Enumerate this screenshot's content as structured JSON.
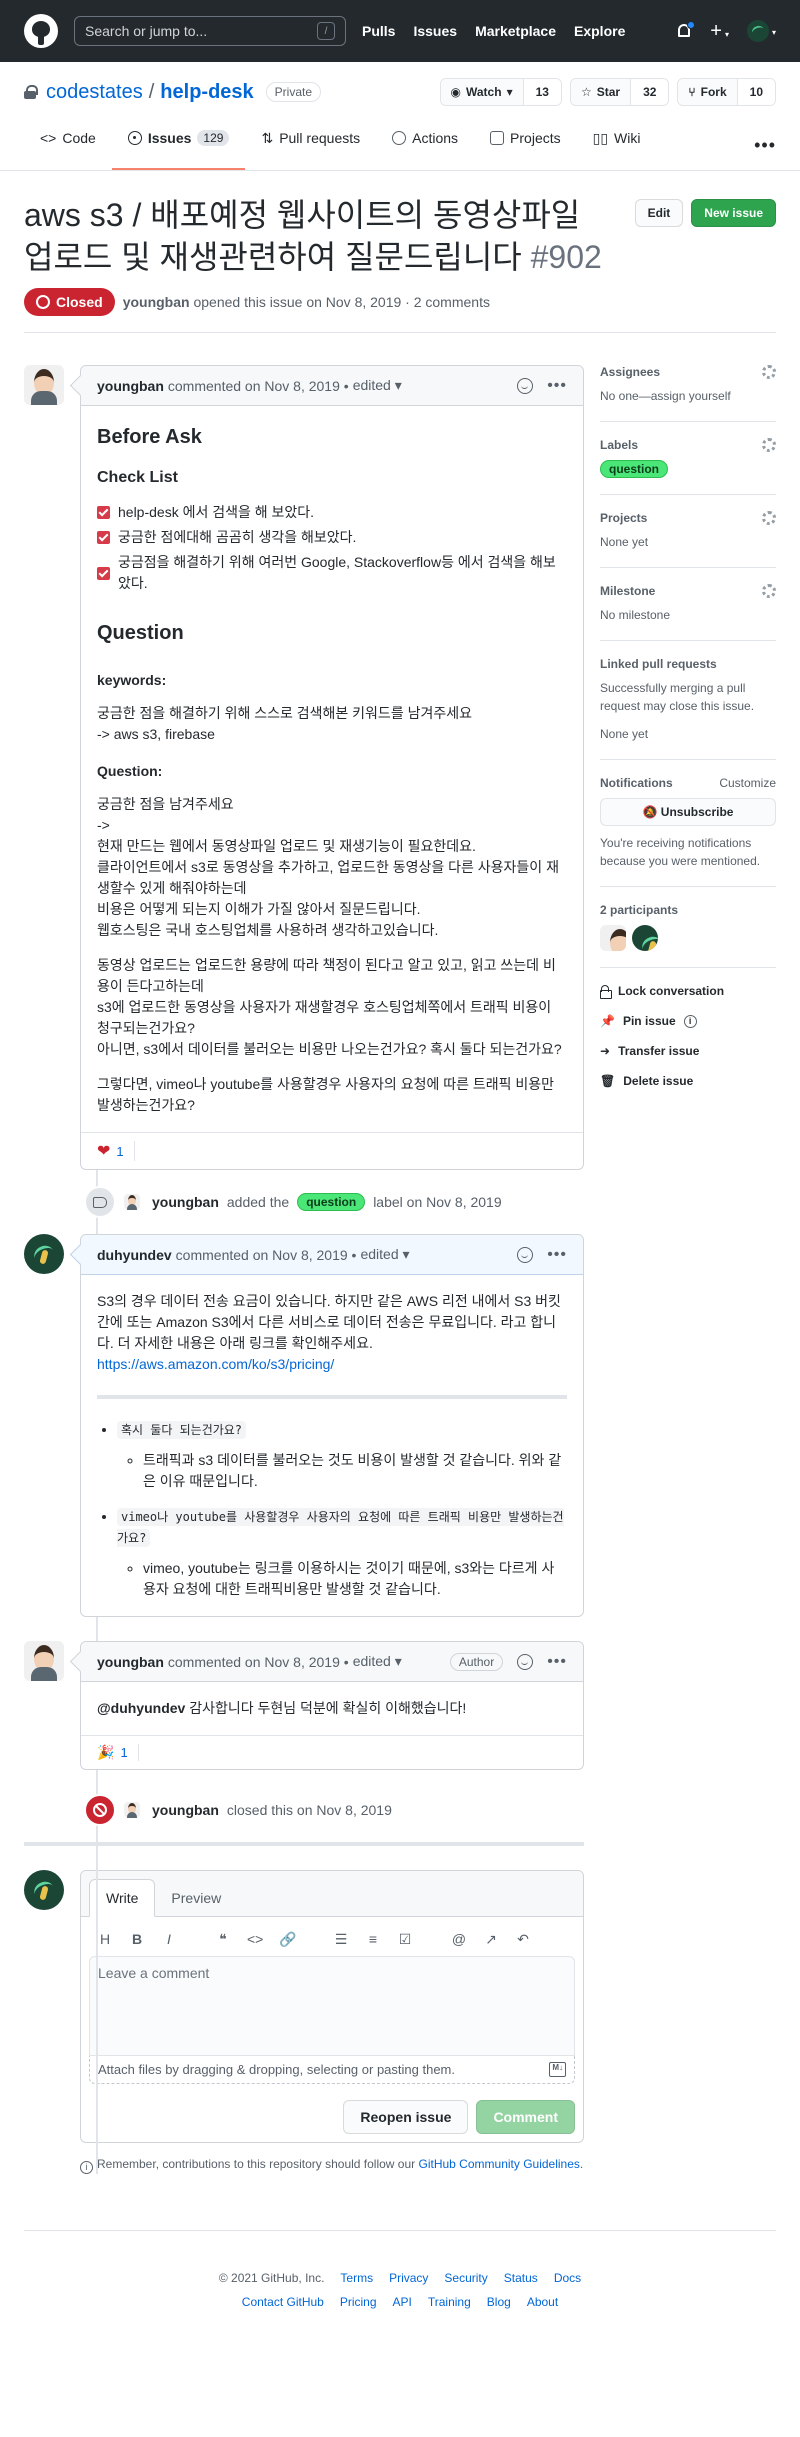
{
  "header": {
    "search_placeholder": "Search or jump to...",
    "slash_key": "/",
    "nav": [
      "Pulls",
      "Issues",
      "Marketplace",
      "Explore"
    ],
    "plus": "+",
    "caret": "▾"
  },
  "repo": {
    "owner": "codestates",
    "sep": "/",
    "name": "help-desk",
    "visibility": "Private",
    "watch_label": "Watch",
    "watch_count": "13",
    "star_label": "Star",
    "star_count": "32",
    "fork_label": "Fork",
    "fork_count": "10"
  },
  "tabs": {
    "code": "Code",
    "issues": "Issues",
    "issues_count": "129",
    "pulls": "Pull requests",
    "actions": "Actions",
    "projects": "Projects",
    "wiki": "Wiki",
    "more": "•••"
  },
  "issue": {
    "title": "aws s3 / 배포예정 웹사이트의 동영상파일 업로드 및 재생관련하여 질문드립니다",
    "number": "#902",
    "edit_label": "Edit",
    "new_issue_label": "New issue",
    "state": "Closed",
    "author": "youngban",
    "opened_text": "opened this issue on Nov 8, 2019 · 2 comments"
  },
  "comment1": {
    "author": "youngban",
    "meta": "commented on Nov 8, 2019 •",
    "edited": "edited ▾",
    "h_before": "Before Ask",
    "h_checklist": "Check List",
    "check1": "help-desk 에서 검색을 해 보았다.",
    "check2": "궁금한 점에대해 곰곰히 생각을 해보았다.",
    "check3": "궁금점을 해결하기 위해 여러번 Google, Stackoverflow등 에서 검색을 해보았다.",
    "h_question": "Question",
    "h_keywords": "keywords:",
    "kw_line1": "궁금한 점을 해결하기 위해 스스로 검색해본 키워드를 남겨주세요",
    "kw_line2": "-> aws s3, firebase",
    "h_question2": "Question:",
    "q_line1": "궁금한 점을 남겨주세요",
    "q_line2": "->",
    "q_line3": "현재 만드는 웹에서 동영상파일 업로드 및 재생기능이 필요한데요.",
    "q_line4": "클라이언트에서 s3로 동영상을 추가하고, 업로드한 동영상을 다른 사용자들이 재생할수 있게 해줘야하는데",
    "q_line5": "비용은 어떻게 되는지 이해가 가질 않아서 질문드립니다.",
    "q_line6": "웹호스팅은 국내 호스팅업체를 사용하려 생각하고있습니다.",
    "p2_line1": "동영상 업로드는 업로드한 용량에 따라 책정이 된다고 알고 있고, 읽고 쓰는데 비용이 든다고하는데",
    "p2_line2": "s3에 업로드한 동영상을 사용자가 재생할경우 호스팅업체쪽에서 트래픽 비용이 청구되는건가요?",
    "p2_line3": "아니면, s3에서 데이터를 불러오는 비용만 나오는건가요? 혹시 둘다 되는건가요?",
    "p3": "그렇다면, vimeo나 youtube를 사용할경우 사용자의 요청에 따른 트래픽 비용만 발생하는건가요?",
    "reaction_icon": "❤",
    "reaction_count": "1"
  },
  "event_label": {
    "actor": "youngban",
    "text_before": "added the",
    "label": "question",
    "text_after": "label on Nov 8, 2019"
  },
  "comment2": {
    "author": "duhyundev",
    "meta": "commented on Nov 8, 2019 •",
    "edited": "edited ▾",
    "p1": "S3의 경우 데이터 전송 요금이 있습니다. 하지만 같은 AWS 리전 내에서 S3 버킷 간에 또는 Amazon S3에서 다른 서비스로 데이터 전송은 무료입니다. 라고 합니다. 더 자세한 내용은 아래 링크를 확인해주세요.",
    "link": "https://aws.amazon.com/ko/s3/pricing/",
    "b1_code": "혹시 둘다 되는건가요?",
    "b1_answer": "트래픽과 s3 데이터를 불러오는 것도 비용이 발생할 것 같습니다. 위와 같은 이유 때문입니다.",
    "b2_code": "vimeo나 youtube를 사용할경우 사용자의 요청에 따른 트래픽 비용만 발생하는건가요?",
    "b2_answer": "vimeo, youtube는 링크를 이용하시는 것이기 때문에, s3와는 다르게 사용자 요청에 대한 트래픽비용만 발생할 것 같습니다."
  },
  "comment3": {
    "author": "youngban",
    "meta": "commented on Nov 8, 2019 •",
    "edited": "edited ▾",
    "badge": "Author",
    "mention": "@duhyundev",
    "body": " 감사합니다 두현님 덕분에 확실히 이해했습니다!",
    "reaction_icon": "🎉",
    "reaction_count": "1"
  },
  "event_closed": {
    "actor": "youngban",
    "text": "closed this on Nov 8, 2019"
  },
  "editor": {
    "tab_write": "Write",
    "tab_preview": "Preview",
    "placeholder": "Leave a comment",
    "attach": "Attach files by dragging & dropping, selecting or pasting them.",
    "md": "M↓",
    "reopen_label": "Reopen issue",
    "comment_label": "Comment",
    "remember_text": "Remember, contributions to this repository should follow our",
    "guidelines_link": "GitHub Community Guidelines",
    "period": "."
  },
  "sidebar": {
    "assignees_h": "Assignees",
    "assignees_v": "No one—assign yourself",
    "labels_h": "Labels",
    "label": "question",
    "projects_h": "Projects",
    "projects_v": "None yet",
    "milestone_h": "Milestone",
    "milestone_v": "No milestone",
    "linked_h": "Linked pull requests",
    "linked_desc": "Successfully merging a pull request may close this issue.",
    "linked_v": "None yet",
    "notif_h": "Notifications",
    "notif_customize": "Customize",
    "unsubscribe": "Unsubscribe",
    "notif_reason": "You're receiving notifications because you were mentioned.",
    "participants_h": "2 participants",
    "lock": "Lock conversation",
    "pin": "Pin issue",
    "transfer": "Transfer issue",
    "delete": "Delete issue"
  },
  "footer": {
    "copyright": "© 2021 GitHub, Inc.",
    "row1": [
      "Terms",
      "Privacy",
      "Security",
      "Status",
      "Docs"
    ],
    "row2": [
      "Contact GitHub",
      "Pricing",
      "API",
      "Training",
      "Blog",
      "About"
    ]
  },
  "colors": {
    "header_bg": "#24292e",
    "closed_red": "#cb2431",
    "green": "#2ea44f",
    "label_green": "#4ae678",
    "link_blue": "#0366d6"
  }
}
